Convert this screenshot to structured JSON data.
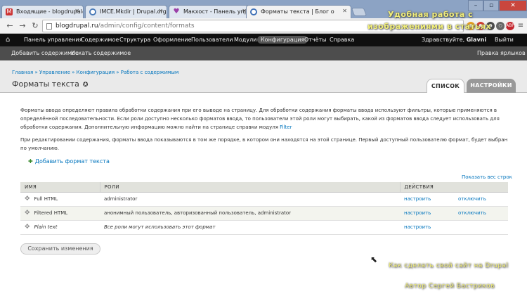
{
  "browser": {
    "tabs": [
      {
        "label": "Входящие - blogdrupal@",
        "icon_color": "#cc3333"
      },
      {
        "label": "IMCE.Mkdir | Drupal.org",
        "icon_color": "#4a7ab8"
      },
      {
        "label": "Макхост - Панель управ",
        "icon_color": "#9b3fa8"
      },
      {
        "label": "Форматы текста | Блог о",
        "icon_color": "#3d6fb6"
      }
    ],
    "url_host": "blogdrupal.ru",
    "url_path": "/admin/config/content/formats"
  },
  "admin_menu": {
    "items": [
      "Панель управления",
      "Содержимое",
      "Структура",
      "Оформление",
      "Пользователи",
      "Модули",
      "Конфигурация",
      "Отчёты",
      "Справка"
    ],
    "greeting_prefix": "Здравствуйте,",
    "user": "Glavni",
    "logout": "Выйти"
  },
  "shortcuts": {
    "add_content": "Добавить содержимое",
    "find_content": "Искать содержимое",
    "edit_shortcuts": "Правка ярлыков"
  },
  "page": {
    "breadcrumb": "Главная » Управление » Конфигурация » Работа с содержимым",
    "title": "Форматы текста",
    "tabs": {
      "list": "СПИСОК",
      "settings": "НАСТРОЙКИ"
    },
    "desc_1": "Форматы ввода определяют правила обработки содержания при его выводе на страницу. Для обработки содержания форматы ввода используют фильтры, которые применяются в определённой последовательности. Если роли доступно несколько форматов ввода, то пользователи этой роли могут выбирать, какой из форматов ввода следует использовать для обработки содержания. Дополнительную информацию можно найти на странице справки модуля",
    "desc_1_link": "Filter",
    "desc_2": "При редактировании содержания, форматы ввода показываются в том же порядке, в котором они находятся на этой странице. Первый доступный пользователю формат, будет выбран по умолчанию.",
    "add_format": "Добавить формат текста",
    "show_weights": "Показать вес строк",
    "save": "Сохранить изменения"
  },
  "table": {
    "headers": {
      "name": "ИМЯ",
      "roles": "РОЛИ",
      "actions": "ДЕЙСТВИЯ"
    },
    "rows": [
      {
        "name": "Full HTML",
        "roles": "administrator",
        "configure": "настроить",
        "disable": "отключить"
      },
      {
        "name": "Filtered HTML",
        "roles": "анонимный пользователь, авторизованный пользователь, administrator",
        "configure": "настроить",
        "disable": "отключить"
      },
      {
        "name": "Plain text",
        "roles": "Все роли могут использовать этот формат",
        "configure": "настроить",
        "disable": ""
      }
    ]
  },
  "watermark": {
    "top_line1": "Удобная работа с",
    "top_line2": "изображениями в статьях",
    "bottom_line1": "Как сделать свой сайт на Drupal",
    "bottom_line2": "Автор Сергей Бастриков"
  }
}
